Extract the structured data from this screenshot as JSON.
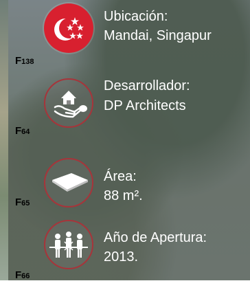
{
  "items": [
    {
      "code_letter": "F",
      "code_num": "138",
      "label": "Ubicación:",
      "value": "Mandai, Singapur",
      "icon": "singapore-flag-icon",
      "color": "#d8202f"
    },
    {
      "code_letter": "F",
      "code_num": "64",
      "label": "Desarrollador:",
      "value": "DP Architects",
      "icon": "house-in-hand-icon",
      "color": "#a7343a"
    },
    {
      "code_letter": "F",
      "code_num": "65",
      "label": "Área:",
      "value": "88 m².",
      "icon": "area-plane-icon",
      "color": "#a7343a"
    },
    {
      "code_letter": "F",
      "code_num": "66",
      "label": "Año de Apertura:",
      "value": "2013.",
      "icon": "ribbon-cutting-icon",
      "color": "#a7343a"
    }
  ]
}
